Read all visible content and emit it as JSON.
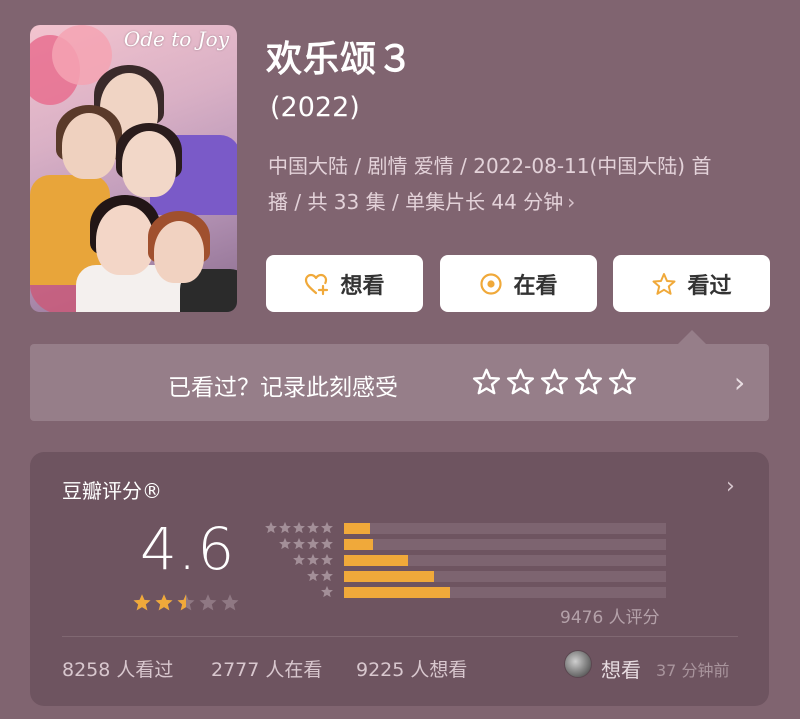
{
  "poster": {
    "title_text": "Ode to Joy",
    "icon": "movie-poster-image"
  },
  "movie": {
    "title": "欢乐颂３",
    "year": "(2022)",
    "meta_line1": "中国大陆 / 剧情 爱情 / 2022-08-11(中国大陆) 首",
    "meta_line2": "播 / 共 33 集 / 单集片长 44 分钟"
  },
  "actions": {
    "want": {
      "label": "想看",
      "icon": "heart-plus-icon"
    },
    "watching": {
      "label": "在看",
      "icon": "target-dot-icon"
    },
    "watched": {
      "label": "看过",
      "icon": "star-outline-icon"
    }
  },
  "rate_prompt": {
    "text": "已看过？记录此刻感受",
    "stars_count": 5
  },
  "douban_score": {
    "title": "豆瓣评分®",
    "score": "4.6",
    "star_rating": 2.5,
    "rating_count": "9476 人评分",
    "distribution": [
      {
        "stars": 5,
        "fraction": 0.08
      },
      {
        "stars": 4,
        "fraction": 0.09
      },
      {
        "stars": 3,
        "fraction": 0.2
      },
      {
        "stars": 2,
        "fraction": 0.28
      },
      {
        "stars": 1,
        "fraction": 0.33
      }
    ]
  },
  "stats": {
    "watched": "8258 人看过",
    "watching": "2777 人在看",
    "want": "9225 人想看"
  },
  "recent_activity": {
    "action": "想看",
    "time": "37 分钟前"
  },
  "colors": {
    "background": "#806470",
    "card": "#6e5460",
    "accent_orange": "#f0a93a",
    "button_bg": "#ffffff"
  }
}
